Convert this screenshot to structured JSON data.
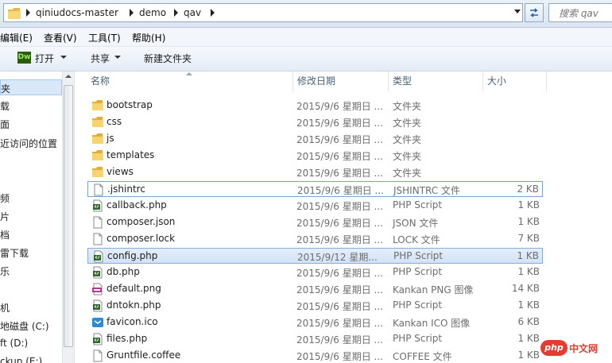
{
  "address": {
    "crumbs": [
      "qiniudocs-master",
      "demo",
      "qav"
    ],
    "search_placeholder": "搜索 qav"
  },
  "menu": [
    "编辑(E)",
    "查看(V)",
    "工具(T)",
    "帮助(H)"
  ],
  "toolbar": {
    "open_icon_text": "Dw",
    "open_label": "打开",
    "share_label": "共享",
    "new_folder_label": "新建文件夹"
  },
  "nav": [
    "夹",
    "载",
    "面",
    "近访问的位置",
    "频",
    "片",
    "档",
    "雷下载",
    "乐",
    "机",
    "地磁盘 (C:)",
    "ft (D:)",
    "ckup (E:)"
  ],
  "columns": {
    "name": "名称",
    "date": "修改日期",
    "type": "类型",
    "size": "大小"
  },
  "files": [
    {
      "name": "bootstrap",
      "date": "2015/9/6 星期日 ...",
      "type": "文件夹",
      "size": "",
      "icon": "folder-icon"
    },
    {
      "name": "css",
      "date": "2015/9/6 星期日 ...",
      "type": "文件夹",
      "size": "",
      "icon": "folder-icon"
    },
    {
      "name": "js",
      "date": "2015/9/6 星期日 ...",
      "type": "文件夹",
      "size": "",
      "icon": "folder-icon"
    },
    {
      "name": "templates",
      "date": "2015/9/6 星期日 ...",
      "type": "文件夹",
      "size": "",
      "icon": "folder-icon"
    },
    {
      "name": "views",
      "date": "2015/9/6 星期日 ...",
      "type": "文件夹",
      "size": "",
      "icon": "folder-icon"
    },
    {
      "name": ".jshintrc",
      "date": "2015/9/6 星期日 ...",
      "type": "JSHINTRC 文件",
      "size": "2 KB",
      "icon": "blank-file-icon"
    },
    {
      "name": "callback.php",
      "date": "2015/9/6 星期日 ...",
      "type": "PHP Script",
      "size": "1 KB",
      "icon": "php-file-icon"
    },
    {
      "name": "composer.json",
      "date": "2015/9/6 星期日 ...",
      "type": "JSON 文件",
      "size": "1 KB",
      "icon": "blank-file-icon"
    },
    {
      "name": "composer.lock",
      "date": "2015/9/6 星期日 ...",
      "type": "LOCK 文件",
      "size": "7 KB",
      "icon": "blank-file-icon"
    },
    {
      "name": "config.php",
      "date": "2015/9/12 星期...",
      "type": "PHP Script",
      "size": "1 KB",
      "icon": "php-file-icon"
    },
    {
      "name": "db.php",
      "date": "2015/9/6 星期日 ...",
      "type": "PHP Script",
      "size": "1 KB",
      "icon": "php-file-icon"
    },
    {
      "name": "default.png",
      "date": "2015/9/6 星期日 ...",
      "type": "Kankan PNG 图像",
      "size": "14 KB",
      "icon": "png-image-icon"
    },
    {
      "name": "dntokn.php",
      "date": "2015/9/6 星期日 ...",
      "type": "PHP Script",
      "size": "1 KB",
      "icon": "php-file-icon"
    },
    {
      "name": "favicon.ico",
      "date": "2015/9/6 星期日 ...",
      "type": "Kankan ICO 图像",
      "size": "6 KB",
      "icon": "ico-image-icon"
    },
    {
      "name": "files.php",
      "date": "2015/9/6 星期日 ...",
      "type": "PHP Script",
      "size": "1 KB",
      "icon": "php-file-icon"
    },
    {
      "name": "Gruntfile.coffee",
      "date": "2015/9/6 星期日 ...",
      "type": "COFFEE 文件",
      "size": "1 KB",
      "icon": "blank-file-icon"
    }
  ],
  "watermark": {
    "badge": "php",
    "text": "中文网"
  }
}
